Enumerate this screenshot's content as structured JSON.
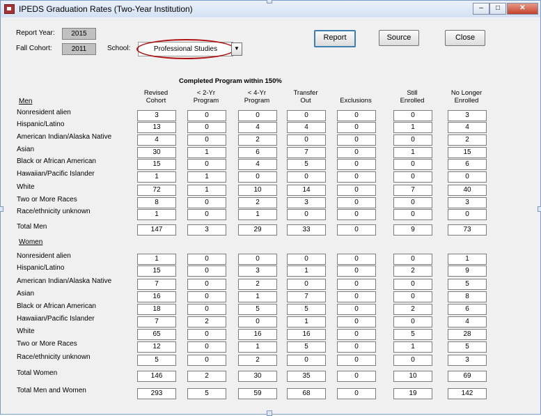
{
  "window": {
    "title": "IPEDS Graduation Rates (Two-Year Institution)",
    "min_glyph": "–",
    "max_glyph": "□",
    "close_glyph": "✕"
  },
  "form": {
    "report_year_label": "Report Year:",
    "report_year": "2015",
    "fall_cohort_label": "Fall Cohort:",
    "fall_cohort": "2011",
    "school_label": "School:",
    "school_value": "Professional Studies",
    "dropdown_glyph": "▼"
  },
  "buttons": {
    "report": "Report",
    "source": "Source",
    "close": "Close"
  },
  "banner": "Completed Program within 150%",
  "columns": [
    [
      "Revised",
      "Cohort"
    ],
    [
      "< 2-Yr",
      "Program"
    ],
    [
      "< 4-Yr",
      "Program"
    ],
    [
      "Transfer",
      "Out"
    ],
    [
      "",
      "Exclusions"
    ],
    [
      "Still",
      "Enrolled"
    ],
    [
      "No Longer",
      "Enrolled"
    ]
  ],
  "men_label": "Men",
  "women_label": "Women",
  "men": [
    {
      "label": "Nonresident alien",
      "values": [
        "3",
        "0",
        "0",
        "0",
        "0",
        "0",
        "3"
      ]
    },
    {
      "label": "Hispanic/Latino",
      "values": [
        "13",
        "0",
        "4",
        "4",
        "0",
        "1",
        "4"
      ]
    },
    {
      "label": "American Indian/Alaska Native",
      "values": [
        "4",
        "0",
        "2",
        "0",
        "0",
        "0",
        "2"
      ]
    },
    {
      "label": "Asian",
      "values": [
        "30",
        "1",
        "6",
        "7",
        "0",
        "1",
        "15"
      ]
    },
    {
      "label": "Black or African American",
      "values": [
        "15",
        "0",
        "4",
        "5",
        "0",
        "0",
        "6"
      ]
    },
    {
      "label": "Hawaiian/Pacific Islander",
      "values": [
        "1",
        "1",
        "0",
        "0",
        "0",
        "0",
        "0"
      ]
    },
    {
      "label": "White",
      "values": [
        "72",
        "1",
        "10",
        "14",
        "0",
        "7",
        "40"
      ]
    },
    {
      "label": "Two or More Races",
      "values": [
        "8",
        "0",
        "2",
        "3",
        "0",
        "0",
        "3"
      ]
    },
    {
      "label": "Race/ethnicity unknown",
      "values": [
        "1",
        "0",
        "1",
        "0",
        "0",
        "0",
        "0"
      ]
    }
  ],
  "total_men": {
    "label": "Total Men",
    "values": [
      "147",
      "3",
      "29",
      "33",
      "0",
      "9",
      "73"
    ]
  },
  "women": [
    {
      "label": "Nonresident alien",
      "values": [
        "1",
        "0",
        "0",
        "0",
        "0",
        "0",
        "1"
      ]
    },
    {
      "label": "Hispanic/Latino",
      "values": [
        "15",
        "0",
        "3",
        "1",
        "0",
        "2",
        "9"
      ]
    },
    {
      "label": "American Indian/Alaska Native",
      "values": [
        "7",
        "0",
        "2",
        "0",
        "0",
        "0",
        "5"
      ]
    },
    {
      "label": "Asian",
      "values": [
        "16",
        "0",
        "1",
        "7",
        "0",
        "0",
        "8"
      ]
    },
    {
      "label": "Black or African American",
      "values": [
        "18",
        "0",
        "5",
        "5",
        "0",
        "2",
        "6"
      ]
    },
    {
      "label": "Hawaiian/Pacific Islander",
      "values": [
        "7",
        "2",
        "0",
        "1",
        "0",
        "0",
        "4"
      ]
    },
    {
      "label": "White",
      "values": [
        "65",
        "0",
        "16",
        "16",
        "0",
        "5",
        "28"
      ]
    },
    {
      "label": "Two or More Races",
      "values": [
        "12",
        "0",
        "1",
        "5",
        "0",
        "1",
        "5"
      ]
    },
    {
      "label": "Race/ethnicity unknown",
      "values": [
        "5",
        "0",
        "2",
        "0",
        "0",
        "0",
        "3"
      ]
    }
  ],
  "total_women": {
    "label": "Total Women",
    "values": [
      "146",
      "2",
      "30",
      "35",
      "0",
      "10",
      "69"
    ]
  },
  "total_all": {
    "label": "Total Men and Women",
    "values": [
      "293",
      "5",
      "59",
      "68",
      "0",
      "19",
      "142"
    ]
  }
}
